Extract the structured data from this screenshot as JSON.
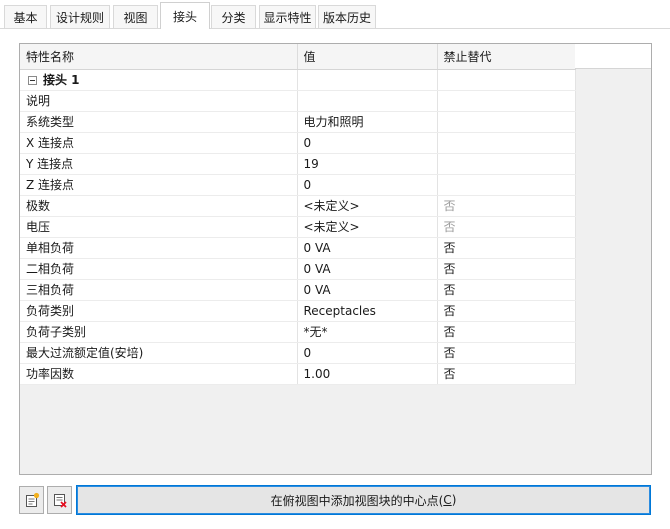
{
  "tabs": [
    {
      "id": "basic",
      "label": "基本"
    },
    {
      "id": "design-rules",
      "label": "设计规则"
    },
    {
      "id": "view",
      "label": "视图"
    },
    {
      "id": "connector",
      "label": "接头"
    },
    {
      "id": "classification",
      "label": "分类"
    },
    {
      "id": "display-properties",
      "label": "显示特性"
    },
    {
      "id": "version-history",
      "label": "版本历史"
    }
  ],
  "active_tab": "接头",
  "grid": {
    "columns": [
      "特性名称",
      "值",
      "禁止替代"
    ],
    "group_label": "接头 1",
    "rows": [
      {
        "name": "说明",
        "value": "",
        "override": ""
      },
      {
        "name": "系统类型",
        "value": "电力和照明",
        "override": ""
      },
      {
        "name": "X 连接点",
        "value": "0",
        "override": ""
      },
      {
        "name": "Y 连接点",
        "value": "19",
        "override": ""
      },
      {
        "name": "Z 连接点",
        "value": "0",
        "override": ""
      },
      {
        "name": "极数",
        "value": "<未定义>",
        "override": "否"
      },
      {
        "name": "电压",
        "value": "<未定义>",
        "override": "否"
      },
      {
        "name": "单相负荷",
        "value": "0 VA",
        "override": "否"
      },
      {
        "name": "二相负荷",
        "value": "0 VA",
        "override": "否"
      },
      {
        "name": "三相负荷",
        "value": "0 VA",
        "override": "否"
      },
      {
        "name": "负荷类别",
        "value": "Receptacles",
        "override": "否"
      },
      {
        "name": "负荷子类别",
        "value": "*无*",
        "override": "否"
      },
      {
        "name": "最大过流额定值(安培)",
        "value": "0",
        "override": "否"
      },
      {
        "name": "功率因数",
        "value": "1.00",
        "override": "否"
      }
    ]
  },
  "toolbar": {
    "add_connector_icon": "add-connector-icon",
    "delete_connector_icon": "delete-connector-icon",
    "center_button_label": "在俯视图中添加视图块的中心点(",
    "center_button_mnemonic": "C",
    "center_button_suffix": ")"
  },
  "colors": {
    "accent": "#0078d7",
    "muted_text": "#9a9a9a",
    "delete_red": "#e81123"
  }
}
